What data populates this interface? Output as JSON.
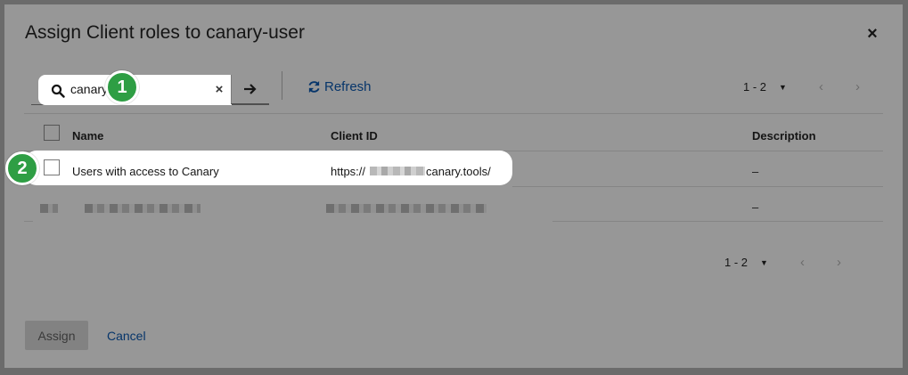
{
  "dialog": {
    "title": "Assign Client roles to canary-user",
    "close_glyph": "×"
  },
  "toolbar": {
    "search_value": "canary",
    "clear_glyph": "×",
    "go_icon": "arrow-right-icon",
    "refresh_label": "Refresh",
    "pagination_label": "1 - 2"
  },
  "table": {
    "headers": {
      "name": "Name",
      "client_id": "Client ID",
      "description": "Description"
    },
    "rows": [
      {
        "name": "Users with access to Canary",
        "client_id_prefix": "https://",
        "client_id_suffix": "canary.tools/",
        "description": "–"
      },
      {
        "name": "",
        "client_id": "",
        "description": "–"
      }
    ]
  },
  "footer_pagination": {
    "label": "1 - 2"
  },
  "actions": {
    "assign": "Assign",
    "cancel": "Cancel"
  },
  "callouts": {
    "one": "1",
    "two": "2"
  },
  "colors": {
    "accent_green": "#2e9e44",
    "link_blue": "#06356a"
  }
}
